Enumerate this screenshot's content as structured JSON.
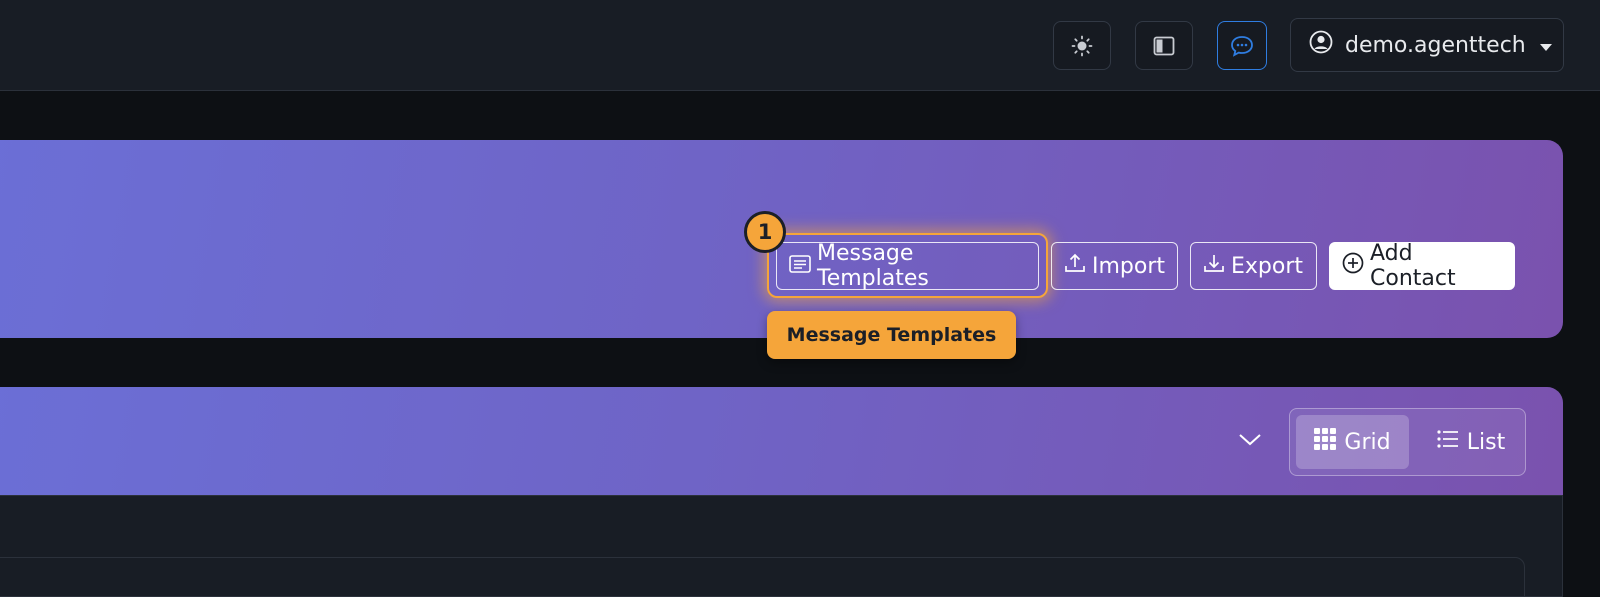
{
  "topbar": {
    "theme_icon": "sun-icon",
    "sidebar_icon": "sidebar-toggle-icon",
    "chat_icon": "chat-bubble-icon",
    "user": {
      "name": "demo.agenttech",
      "icon": "user-circle-icon"
    }
  },
  "hero": {
    "actions": {
      "templates_label": "Message Templates",
      "import_label": "Import",
      "export_label": "Export",
      "add_label": "Add Contact"
    }
  },
  "guide": {
    "step_number": "1",
    "tooltip_text": "Message Templates",
    "highlight_color": "#f5a53a"
  },
  "view_toggle": {
    "grid_label": "Grid",
    "list_label": "List",
    "selected": "Grid"
  },
  "colors": {
    "accent": "#2f7de1",
    "gradient_start": "#6b6fd6",
    "gradient_end": "#7a52ae",
    "topbar_bg": "#181d25"
  }
}
